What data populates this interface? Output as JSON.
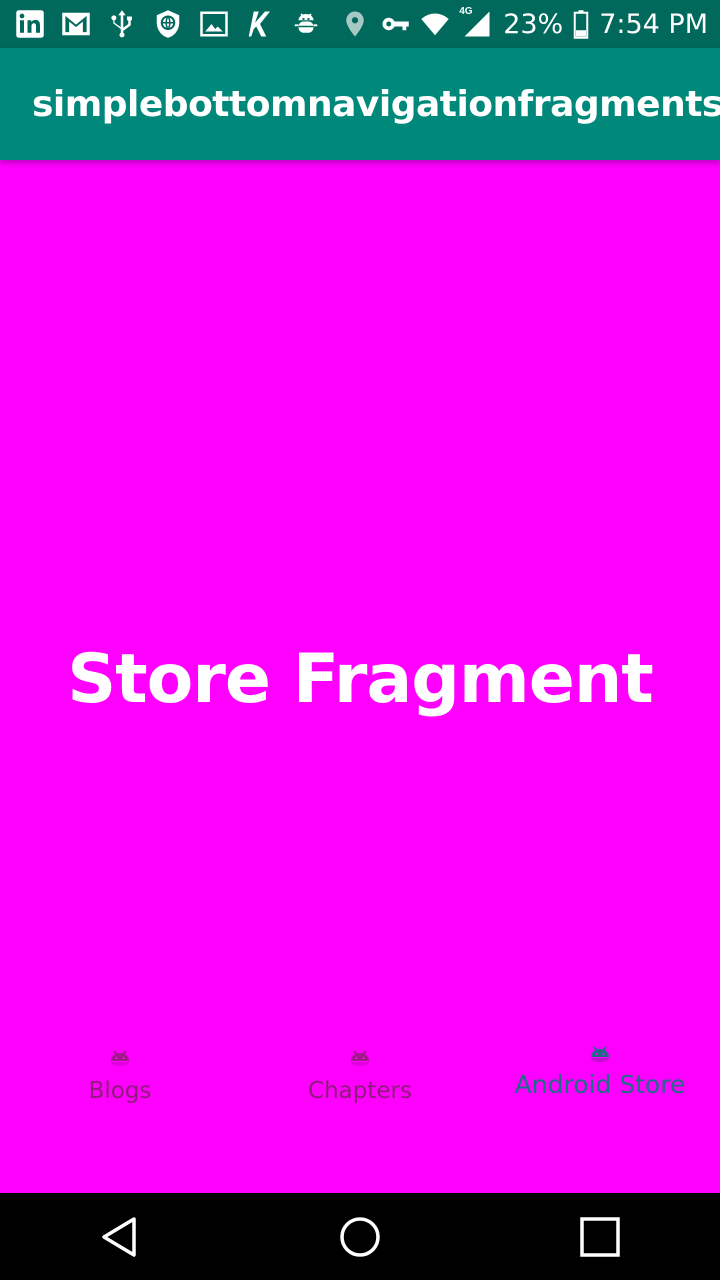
{
  "status_bar": {
    "battery": "23%",
    "time": "7:54 PM",
    "network": "4G",
    "left_icons": [
      "linkedin-icon",
      "gmail-icon",
      "usb-icon",
      "shield-icon",
      "image-icon",
      "k-app-icon",
      "android-debug-icon"
    ],
    "right_icons": [
      "location-icon",
      "vpn-key-icon",
      "wifi-icon",
      "cell-signal-icon",
      "battery-icon"
    ]
  },
  "app_bar": {
    "title": "simplebottomnavigationfragments"
  },
  "content": {
    "fragment_title": "Store Fragment",
    "background": "#ff00ff"
  },
  "bottom_nav": {
    "items": [
      {
        "label": "Blogs",
        "icon": "android-icon",
        "active": false
      },
      {
        "label": "Chapters",
        "icon": "android-icon",
        "active": false
      },
      {
        "label": "Android Store",
        "icon": "android-icon",
        "active": true
      }
    ],
    "inactive_color": "#8e1c7a",
    "active_color": "#1e6b8a"
  },
  "system_nav": {
    "buttons": [
      "back-icon",
      "home-icon",
      "recents-icon"
    ]
  },
  "colors": {
    "status_bar": "#00695c",
    "app_bar": "#00897b"
  }
}
